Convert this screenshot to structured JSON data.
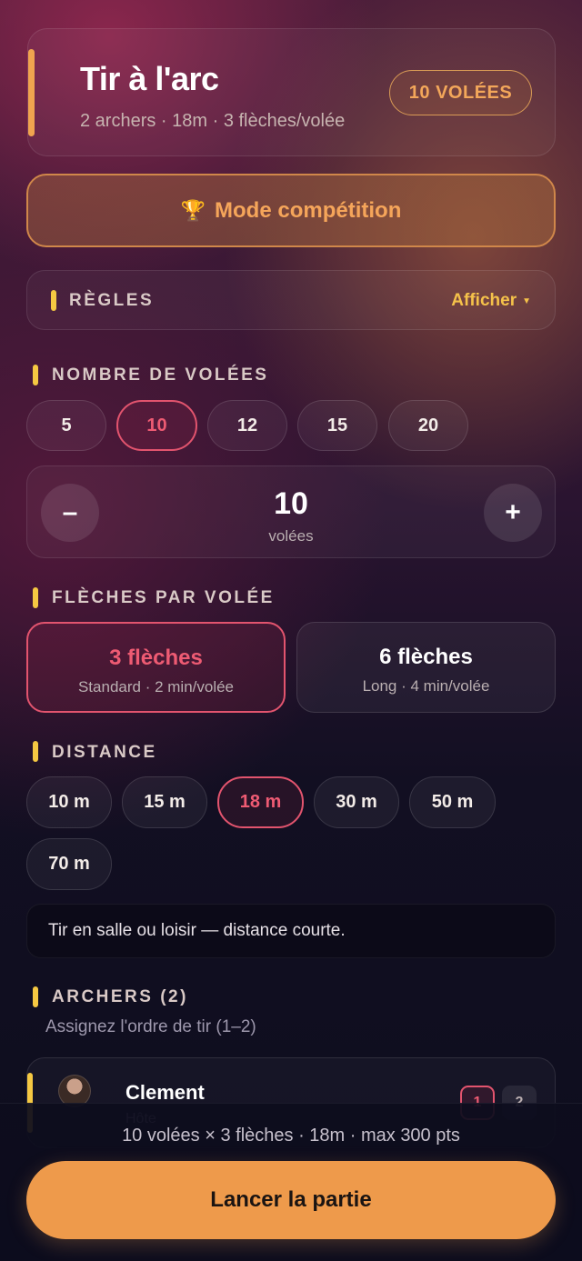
{
  "header": {
    "title": "Tir à l'arc",
    "subtitle": "2 archers · 18m · 3 flèches/volée",
    "badge": "10 VOLÉES"
  },
  "competition": {
    "icon": "trophy-icon",
    "label": "Mode compétition"
  },
  "rules": {
    "label": "RÈGLES",
    "toggle": "Afficher",
    "toggle_icon": "caret-down-icon"
  },
  "volleys": {
    "title": "NOMBRE DE VOLÉES",
    "options": [
      "5",
      "10",
      "12",
      "15",
      "20"
    ],
    "selected": "10",
    "stepper": {
      "minus": "–",
      "value": "10",
      "unit": "volées",
      "plus": "+"
    }
  },
  "arrows": {
    "title": "FLÈCHES PAR VOLÉE",
    "options": [
      {
        "label": "3 flèches",
        "sub": "Standard · 2 min/volée"
      },
      {
        "label": "6 flèches",
        "sub": "Long · 4 min/volée"
      }
    ],
    "selected": "3 flèches"
  },
  "distance": {
    "title": "DISTANCE",
    "options": [
      "10 m",
      "15 m",
      "18 m",
      "30 m",
      "50 m",
      "70 m"
    ],
    "selected": "18 m",
    "note": "Tir en salle ou loisir — distance courte."
  },
  "archers": {
    "title": "ARCHERS (2)",
    "subtitle": "Assignez l'ordre de tir (1–2)",
    "list": [
      {
        "name": "Clement",
        "role": "Hôte",
        "orders": [
          "1",
          "2"
        ],
        "selected_order": "1"
      }
    ]
  },
  "footer": {
    "summary": "10 volées × 3 flèches · 18m · max 300 pts",
    "launch": "Lancer la partie"
  },
  "colors": {
    "accent_orange": "#ee9a4b",
    "accent_yellow": "#f5c842",
    "selected_pink": "#e2546e"
  }
}
